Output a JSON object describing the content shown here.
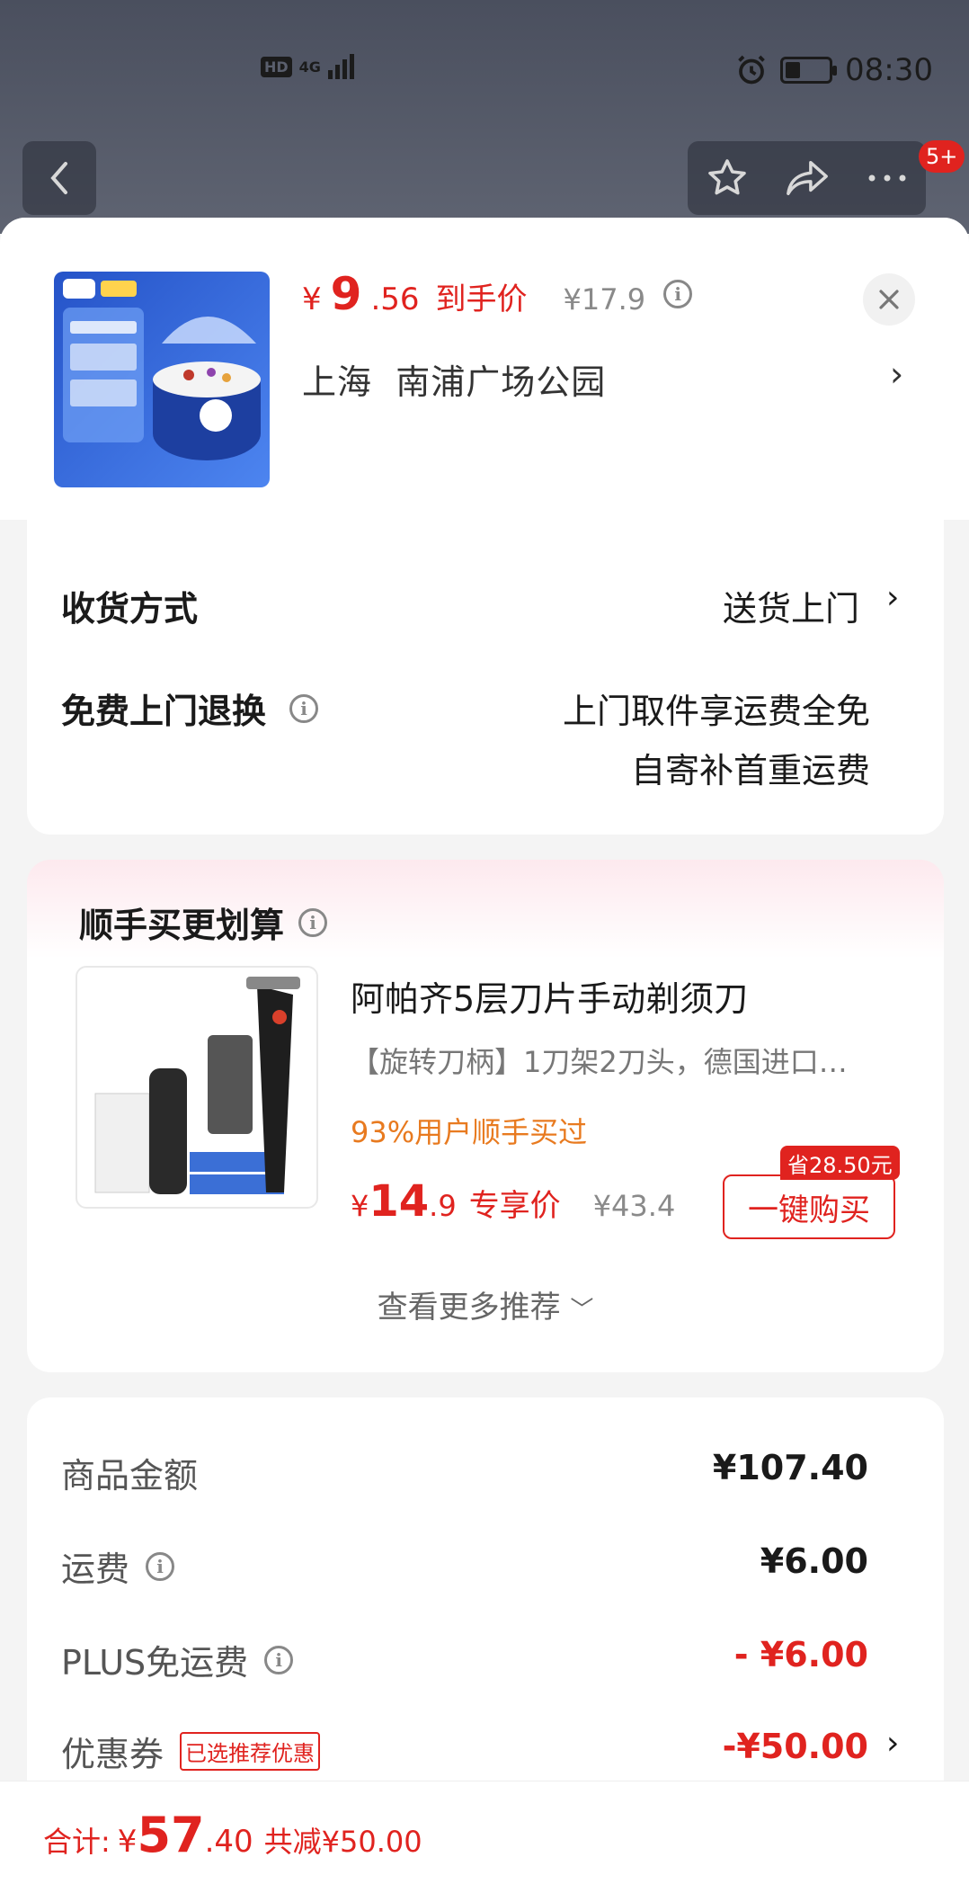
{
  "status_bar": {
    "network": "HD",
    "signal": "4G",
    "time": "08:30",
    "battery_level": 0.35
  },
  "nav": {
    "notification_count": "5+"
  },
  "product": {
    "price_yen": "¥",
    "price_int": "9",
    "price_dec": ".56",
    "price_tag": "到手价",
    "original_price": "¥17.9",
    "location_city": "上海",
    "location_place": "南浦广场公园"
  },
  "delivery": {
    "method_label": "收货方式",
    "method_value": "送货上门",
    "return_label": "免费上门退换",
    "return_line1": "上门取件享运费全免",
    "return_line2": "自寄补首重运费"
  },
  "recommend": {
    "title": "顺手买更划算",
    "item_name": "阿帕齐5层刀片手动剃须刀",
    "item_desc": "【旋转刀柄】1刀架2刀头，德国进口…",
    "buyers": "93%用户顺手买过",
    "price_yen": "¥",
    "price_int": "14",
    "price_dec": ".9",
    "price_tag": "专享价",
    "original_price": "¥43.4",
    "save_badge": "省28.50元",
    "buy_button": "一键购买",
    "see_more": "查看更多推荐"
  },
  "fees": {
    "goods_label": "商品金额",
    "goods_value": "¥107.40",
    "shipping_label": "运费",
    "shipping_value": "¥6.00",
    "plus_label": "PLUS免运费",
    "plus_value": "- ¥6.00",
    "coupon_label": "优惠券",
    "coupon_tag": "已选推荐优惠",
    "coupon_value": "-¥50.00"
  },
  "summary": {
    "total_label": "合计:",
    "total_yen": "¥",
    "total_int": "57",
    "total_dec": ".40",
    "saved": "共减¥50.00"
  },
  "colors": {
    "accent": "#e0231f",
    "orange": "#e87a1f"
  }
}
